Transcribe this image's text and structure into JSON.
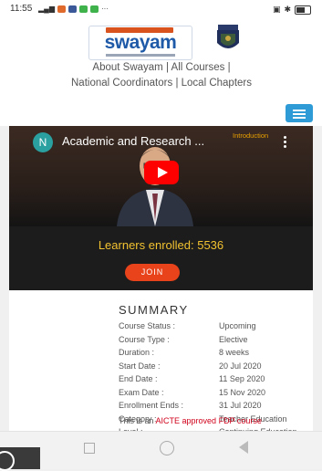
{
  "statusbar": {
    "time": "11:55"
  },
  "header": {
    "logo_text": "swayam",
    "nav": {
      "about": "About Swayam",
      "courses": "All Courses",
      "coordinators": "National Coordinators",
      "chapters": "Local Chapters",
      "separator": "|"
    }
  },
  "video": {
    "avatar_letter": "N",
    "title": "Academic and Research ...",
    "intro_tag": "Introduction"
  },
  "course": {
    "learners_enrolled": "Learners enrolled: 5536",
    "join_label": "JOIN"
  },
  "summary": {
    "title": "SUMMARY",
    "rows": [
      {
        "label": "Course Status :",
        "value": "Upcoming"
      },
      {
        "label": "Course Type :",
        "value": "Elective"
      },
      {
        "label": "Duration :",
        "value": "8 weeks"
      },
      {
        "label": "Start Date :",
        "value": "20 Jul 2020"
      },
      {
        "label": "End Date :",
        "value": "11 Sep 2020"
      },
      {
        "label": "Exam Date :",
        "value": "15 Nov 2020"
      },
      {
        "label": "Enrollment Ends :",
        "value": "31 Jul 2020"
      },
      {
        "label": "Category :",
        "value": "Teacher Education"
      },
      {
        "label": "Level :",
        "value": "Continuing Education"
      }
    ],
    "note_prefix": "This is an",
    "note_highlight": "AICTE approved FDP course"
  },
  "colors": {
    "accent_blue": "#2e9bd6",
    "join_orange": "#e8431a",
    "learners_yellow": "#f2c230",
    "aicte_red": "#d0021b",
    "youtube_red": "#ff0000"
  }
}
